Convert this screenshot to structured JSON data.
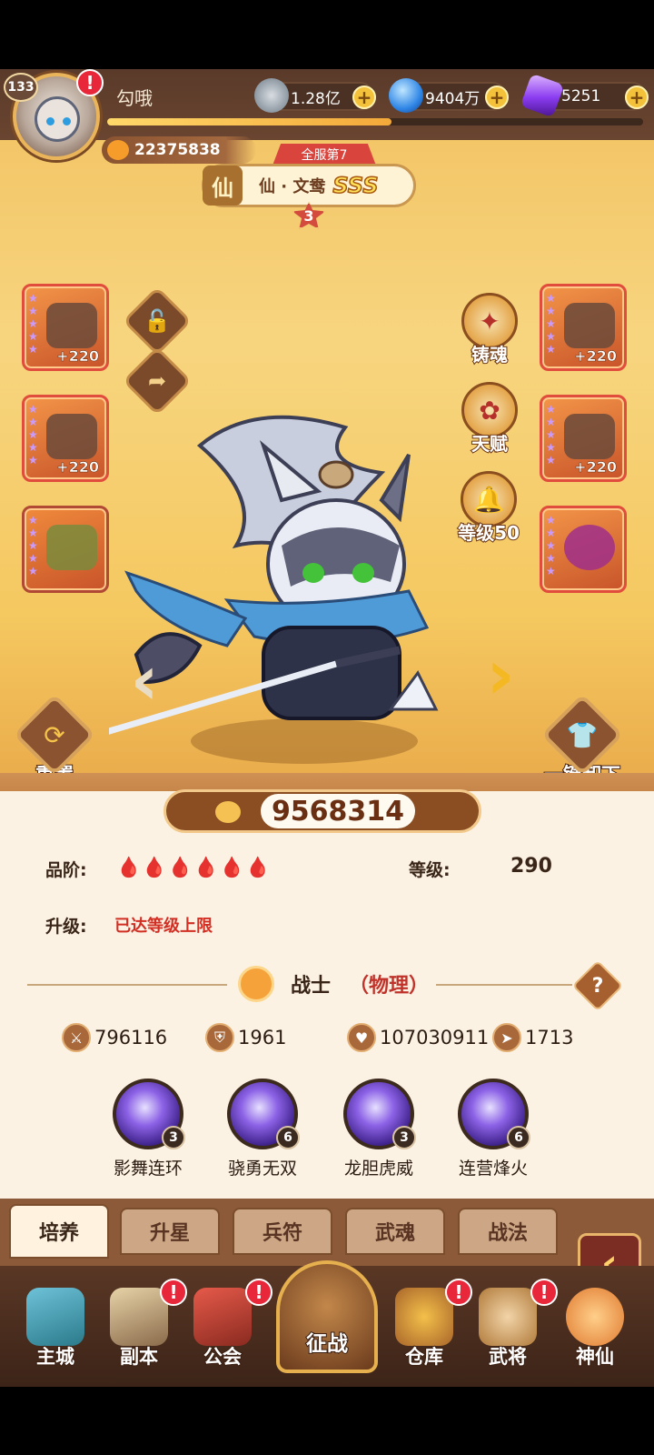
{
  "player": {
    "level": "133",
    "name": "勾哦",
    "power": "22375838",
    "exp_fraction": 0.53
  },
  "resources": [
    {
      "name": "coin-icon",
      "value": "1.28亿",
      "color": "#9aa7b3"
    },
    {
      "name": "blue-orb-icon",
      "value": "9404万",
      "color": "#2f86e6"
    },
    {
      "name": "purple-crystal-icon",
      "value": "5251",
      "color": "#8a3cf0"
    }
  ],
  "hero": {
    "server_rank": "全服第7",
    "title_emblem": "仙",
    "title": "仙 · 文鸯",
    "grade": "SSS",
    "stars": "3",
    "total_power": "9568314"
  },
  "equipment": [
    {
      "bonus": "+220"
    },
    {
      "bonus": "+220"
    },
    {
      "bonus": ""
    },
    {
      "bonus": "+220"
    },
    {
      "bonus": "+220"
    },
    {
      "bonus": ""
    }
  ],
  "functions": {
    "forge_soul": "铸魂",
    "talent": "天赋",
    "level": "等级50",
    "reset": "重置",
    "unequip_all": "一键卸下"
  },
  "attributes": {
    "grade_label": "品阶:",
    "grade_icons": "🩸🩸🩸🩸🩸🩸",
    "level_label": "等级:",
    "level_value": "290",
    "upgrade_label": "升级:",
    "upgrade_status": "已达等级上限"
  },
  "class_info": {
    "name": "战士",
    "type": "（物理）",
    "help": "?"
  },
  "stats": [
    {
      "icon": "sword-icon",
      "value": "796116"
    },
    {
      "icon": "shield-icon",
      "value": "1961"
    },
    {
      "icon": "heart-icon",
      "value": "107030911"
    },
    {
      "icon": "speed-icon",
      "value": "1713"
    }
  ],
  "skills": [
    {
      "name": "影舞连环",
      "level": "3"
    },
    {
      "name": "骁勇无双",
      "level": "6"
    },
    {
      "name": "龙胆虎威",
      "level": "3"
    },
    {
      "name": "连营烽火",
      "level": "6"
    }
  ],
  "tabs": [
    {
      "label": "培养",
      "active": true
    },
    {
      "label": "升星",
      "active": false
    },
    {
      "label": "兵符",
      "active": false
    },
    {
      "label": "武魂",
      "active": false
    },
    {
      "label": "战法",
      "active": false
    }
  ],
  "nav": [
    {
      "label": "主城",
      "alert": false
    },
    {
      "label": "副本",
      "alert": true
    },
    {
      "label": "公会",
      "alert": true
    },
    {
      "label": "征战",
      "alert": false
    },
    {
      "label": "仓库",
      "alert": true
    },
    {
      "label": "武将",
      "alert": true
    },
    {
      "label": "神仙",
      "alert": false
    }
  ],
  "alert_mark": "!",
  "back_glyph": "‹"
}
